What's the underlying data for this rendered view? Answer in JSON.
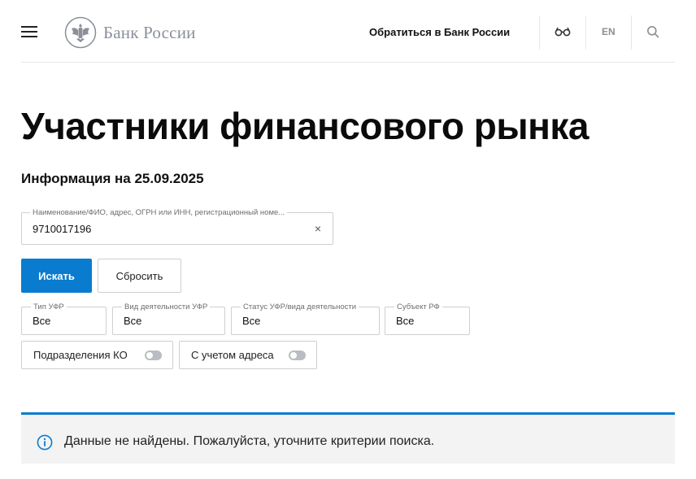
{
  "header": {
    "logo_text": "Банк России",
    "contact_link": "Обратиться в Банк России",
    "lang": "EN"
  },
  "page": {
    "title": "Участники финансового рынка",
    "info_date": "Информация на 25.09.2025"
  },
  "search": {
    "label": "Наименование/ФИО, адрес, ОГРН или ИНН, регистрационный номе...",
    "value": "9710017196",
    "clear": "×"
  },
  "buttons": {
    "search_label": "Искать",
    "reset_label": "Сбросить"
  },
  "filters": [
    {
      "label": "Тип УФР",
      "value": "Все"
    },
    {
      "label": "Вид деятельности УФР",
      "value": "Все"
    },
    {
      "label": "Статус УФР/вида деятельности",
      "value": "Все"
    },
    {
      "label": "Субъект РФ",
      "value": "Все"
    }
  ],
  "toggles": [
    {
      "label": "Подразделения КО",
      "on": false
    },
    {
      "label": "С учетом адреса",
      "on": false
    }
  ],
  "notice": {
    "text": "Данные не найдены. Пожалуйста, уточните критерии поиска."
  },
  "colors": {
    "accent": "#0a7ccf",
    "notice_bg": "#f3f3f3",
    "logo_gray": "#8a8f98"
  },
  "icons": [
    "menu-icon",
    "bank-emblem-icon",
    "glasses-icon",
    "search-icon",
    "info-icon",
    "close-icon"
  ]
}
